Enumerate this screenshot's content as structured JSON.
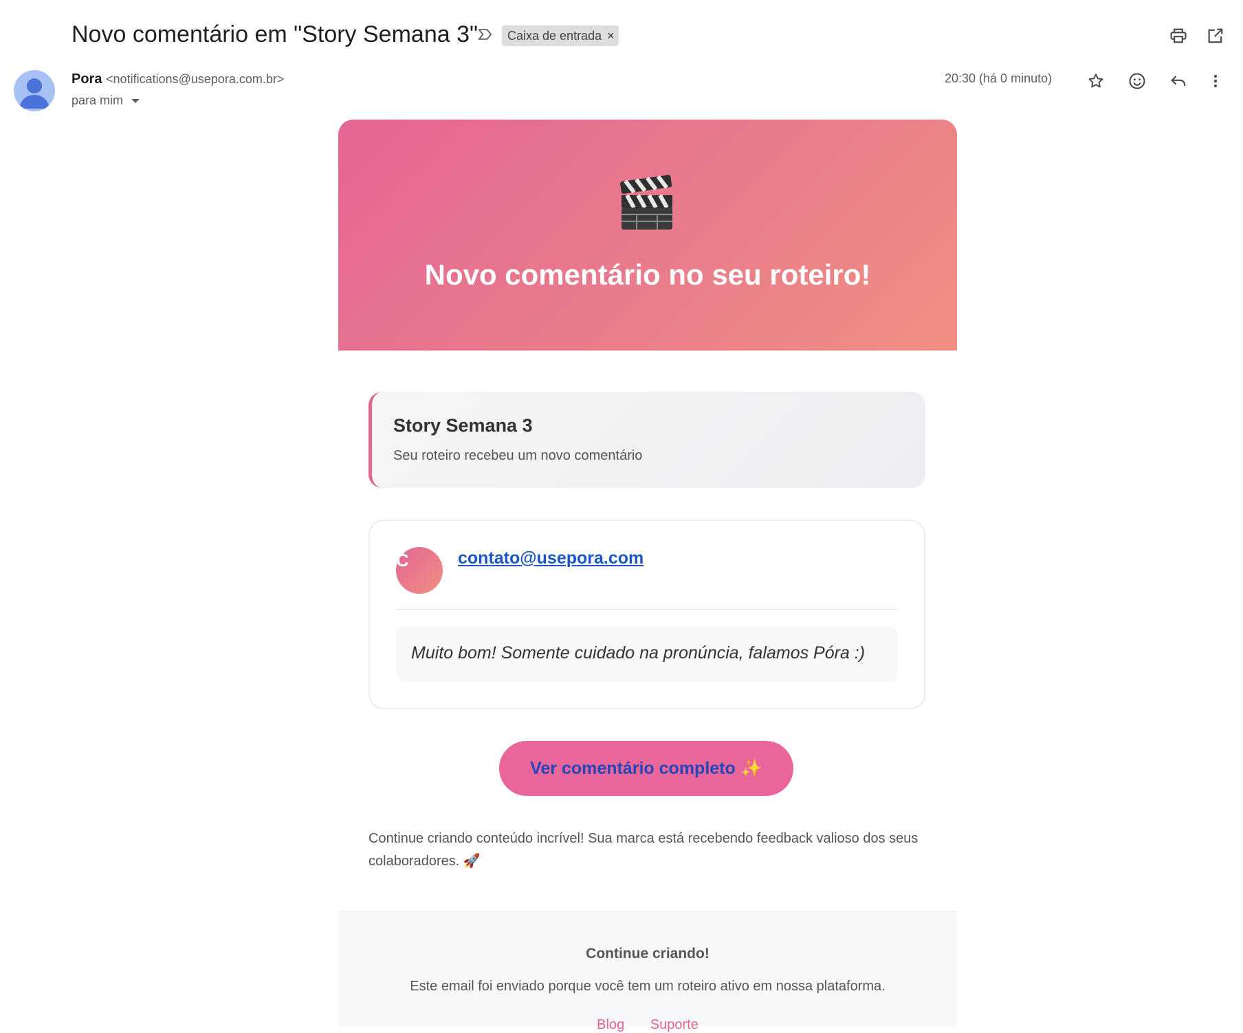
{
  "header": {
    "subject": "Novo comentário em \"Story Semana 3\"",
    "label_chip": "Caixa de entrada",
    "label_remove": "×",
    "icons": [
      "label-icon",
      "print-icon",
      "open-in-new-window-icon"
    ]
  },
  "message": {
    "sender_name": "Pora",
    "sender_email": "<notifications@usepora.com.br>",
    "recipient": "para mim",
    "timestamp": "20:30 (há 0 minuto)",
    "action_icons": [
      "star-icon",
      "emoji-icon",
      "reply-icon",
      "more-vert-icon"
    ]
  },
  "email": {
    "hero_emoji": "🎬",
    "hero_title": "Novo comentário no seu roteiro!",
    "script_title": "Story Semana 3",
    "script_subtitle": "Seu roteiro recebeu um novo comentário",
    "commenter_initial": "C",
    "commenter_email": "contato@usepora.com",
    "comment_text": "Muito bom! Somente cuidado na pronúncia, falamos Póra :)",
    "cta_label": "Ver comentário completo",
    "cta_emoji": "✨",
    "outro_text": "Continue criando conteúdo incrível! Sua marca está recebendo feedback valioso dos seus colaboradores. 🚀",
    "footer_title": "Continue criando!",
    "footer_text": "Este email foi enviado porque você tem um roteiro ativo em nossa plataforma.",
    "footer_links": [
      "Blog",
      "Suporte"
    ]
  },
  "colors": {
    "accent_pink": "#e46593",
    "accent_coral": "#f08f82",
    "link_blue": "#1a56c4"
  }
}
